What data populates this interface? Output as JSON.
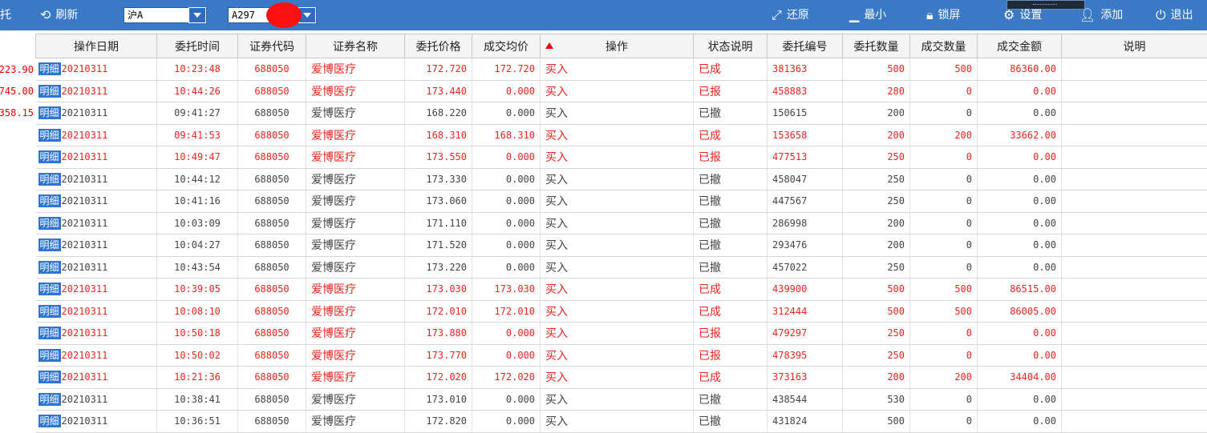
{
  "toolbar": {
    "partial_left": "托",
    "refresh": "刷新",
    "market": "沪A",
    "account": "A297",
    "restore": "还原",
    "minimize": "最小",
    "lock": "锁屏",
    "settings": "设置",
    "add": "添加",
    "exit": "退出"
  },
  "left_values": [
    "223.90",
    "745.00",
    "358.15"
  ],
  "table": {
    "headers": [
      "操作日期",
      "委托时间",
      "证券代码",
      "证券名称",
      "委托价格",
      "成交均价",
      "操作",
      "状态说明",
      "委托编号",
      "委托数量",
      "成交数量",
      "成交金额",
      "说明"
    ],
    "detail_label": "明细",
    "rows": [
      {
        "date": "20210311",
        "time": "10:23:48",
        "code": "688050",
        "name": "爱博医疗",
        "price": "172.720",
        "avg": "172.720",
        "op": "买入",
        "status": "已成",
        "no": "381363",
        "qty": "500",
        "deal_qty": "500",
        "amount": "86360.00",
        "red": true
      },
      {
        "date": "20210311",
        "time": "10:44:26",
        "code": "688050",
        "name": "爱博医疗",
        "price": "173.440",
        "avg": "0.000",
        "op": "买入",
        "status": "已报",
        "no": "458883",
        "qty": "280",
        "deal_qty": "0",
        "amount": "0.00",
        "red": true
      },
      {
        "date": "20210311",
        "time": "09:41:27",
        "code": "688050",
        "name": "爱博医疗",
        "price": "168.220",
        "avg": "0.000",
        "op": "买入",
        "status": "已撤",
        "no": "150615",
        "qty": "200",
        "deal_qty": "0",
        "amount": "0.00",
        "red": false
      },
      {
        "date": "20210311",
        "time": "09:41:53",
        "code": "688050",
        "name": "爱博医疗",
        "price": "168.310",
        "avg": "168.310",
        "op": "买入",
        "status": "已成",
        "no": "153658",
        "qty": "200",
        "deal_qty": "200",
        "amount": "33662.00",
        "red": true
      },
      {
        "date": "20210311",
        "time": "10:49:47",
        "code": "688050",
        "name": "爱博医疗",
        "price": "173.550",
        "avg": "0.000",
        "op": "买入",
        "status": "已报",
        "no": "477513",
        "qty": "250",
        "deal_qty": "0",
        "amount": "0.00",
        "red": true
      },
      {
        "date": "20210311",
        "time": "10:44:12",
        "code": "688050",
        "name": "爱博医疗",
        "price": "173.330",
        "avg": "0.000",
        "op": "买入",
        "status": "已撤",
        "no": "458047",
        "qty": "250",
        "deal_qty": "0",
        "amount": "0.00",
        "red": false
      },
      {
        "date": "20210311",
        "time": "10:41:16",
        "code": "688050",
        "name": "爱博医疗",
        "price": "173.060",
        "avg": "0.000",
        "op": "买入",
        "status": "已撤",
        "no": "447567",
        "qty": "250",
        "deal_qty": "0",
        "amount": "0.00",
        "red": false
      },
      {
        "date": "20210311",
        "time": "10:03:09",
        "code": "688050",
        "name": "爱博医疗",
        "price": "171.110",
        "avg": "0.000",
        "op": "买入",
        "status": "已撤",
        "no": "286998",
        "qty": "200",
        "deal_qty": "0",
        "amount": "0.00",
        "red": false
      },
      {
        "date": "20210311",
        "time": "10:04:27",
        "code": "688050",
        "name": "爱博医疗",
        "price": "171.520",
        "avg": "0.000",
        "op": "买入",
        "status": "已撤",
        "no": "293476",
        "qty": "200",
        "deal_qty": "0",
        "amount": "0.00",
        "red": false
      },
      {
        "date": "20210311",
        "time": "10:43:54",
        "code": "688050",
        "name": "爱博医疗",
        "price": "173.220",
        "avg": "0.000",
        "op": "买入",
        "status": "已撤",
        "no": "457022",
        "qty": "250",
        "deal_qty": "0",
        "amount": "0.00",
        "red": false
      },
      {
        "date": "20210311",
        "time": "10:39:05",
        "code": "688050",
        "name": "爱博医疗",
        "price": "173.030",
        "avg": "173.030",
        "op": "买入",
        "status": "已成",
        "no": "439900",
        "qty": "500",
        "deal_qty": "500",
        "amount": "86515.00",
        "red": true
      },
      {
        "date": "20210311",
        "time": "10:08:10",
        "code": "688050",
        "name": "爱博医疗",
        "price": "172.010",
        "avg": "172.010",
        "op": "买入",
        "status": "已成",
        "no": "312444",
        "qty": "500",
        "deal_qty": "500",
        "amount": "86005.00",
        "red": true
      },
      {
        "date": "20210311",
        "time": "10:50:18",
        "code": "688050",
        "name": "爱博医疗",
        "price": "173.880",
        "avg": "0.000",
        "op": "买入",
        "status": "已报",
        "no": "479297",
        "qty": "250",
        "deal_qty": "0",
        "amount": "0.00",
        "red": true
      },
      {
        "date": "20210311",
        "time": "10:50:02",
        "code": "688050",
        "name": "爱博医疗",
        "price": "173.770",
        "avg": "0.000",
        "op": "买入",
        "status": "已报",
        "no": "478395",
        "qty": "250",
        "deal_qty": "0",
        "amount": "0.00",
        "red": true
      },
      {
        "date": "20210311",
        "time": "10:21:36",
        "code": "688050",
        "name": "爱博医疗",
        "price": "172.020",
        "avg": "172.020",
        "op": "买入",
        "status": "已成",
        "no": "373163",
        "qty": "200",
        "deal_qty": "200",
        "amount": "34404.00",
        "red": true
      },
      {
        "date": "20210311",
        "time": "10:38:41",
        "code": "688050",
        "name": "爱博医疗",
        "price": "173.010",
        "avg": "0.000",
        "op": "买入",
        "status": "已撤",
        "no": "438544",
        "qty": "530",
        "deal_qty": "0",
        "amount": "0.00",
        "red": false
      },
      {
        "date": "20210311",
        "time": "10:36:51",
        "code": "688050",
        "name": "爱博医疗",
        "price": "172.820",
        "avg": "0.000",
        "op": "买入",
        "status": "已撤",
        "no": "431824",
        "qty": "500",
        "deal_qty": "0",
        "amount": "0.00",
        "red": false
      }
    ]
  },
  "colors": {
    "toolbar_bg": "#3a79c6",
    "buy_red": "#e8261f",
    "detail_blue": "#2d75d0",
    "redaction": "#ff1010"
  },
  "icons": [
    "refresh-icon",
    "restore-icon",
    "minimize-icon",
    "lock-icon",
    "settings-icon",
    "add-user-icon",
    "power-icon"
  ]
}
